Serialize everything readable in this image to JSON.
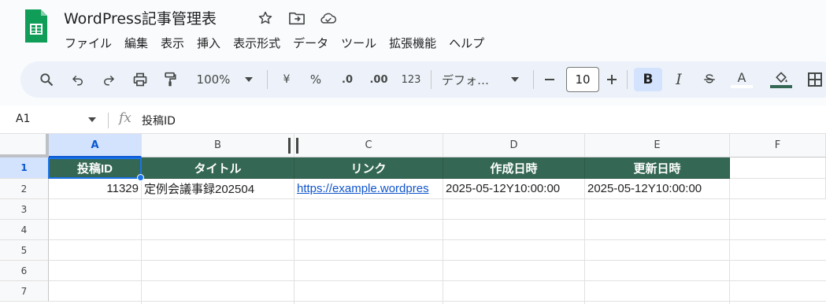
{
  "document": {
    "title": "WordPress記事管理表",
    "title_icons": [
      "star-icon",
      "move-to-folder-icon",
      "cloud-saved-icon"
    ]
  },
  "menu": [
    "ファイル",
    "編集",
    "表示",
    "挿入",
    "表示形式",
    "データ",
    "ツール",
    "拡張機能",
    "ヘルプ"
  ],
  "toolbar": {
    "zoom": "100%",
    "currency": "¥",
    "percent": "%",
    "decrease_decimal": ".0",
    "increase_decimal": ".00",
    "number_format": "123",
    "font": "デフォ…",
    "font_size": "10",
    "bold": "B",
    "italic": "I",
    "text_color": "A",
    "fill_color": "#356854",
    "icons": [
      "search-icon",
      "undo-icon",
      "redo-icon",
      "print-icon",
      "paint-format-icon",
      "minus-icon",
      "plus-icon",
      "strikethrough-icon",
      "fill-color-icon",
      "borders-icon"
    ]
  },
  "formula_bar": {
    "cell_ref": "A1",
    "fx": "fx",
    "content": "投稿ID"
  },
  "sheet": {
    "columns": [
      "A",
      "B",
      "C",
      "D",
      "E",
      "F"
    ],
    "rows": [
      "1",
      "2",
      "3",
      "4",
      "5",
      "6",
      "7"
    ],
    "header_row": [
      "投稿ID",
      "タイトル",
      "リンク",
      "作成日時",
      "更新日時"
    ],
    "data_row": {
      "id": "11329",
      "title": "定例会議事録202504",
      "link": "https://example.wordpres",
      "created": "2025-05-12Y10:00:00",
      "updated": "2025-05-12Y10:00:00"
    },
    "header_fill": "#356854",
    "selected_cell": "A1"
  }
}
